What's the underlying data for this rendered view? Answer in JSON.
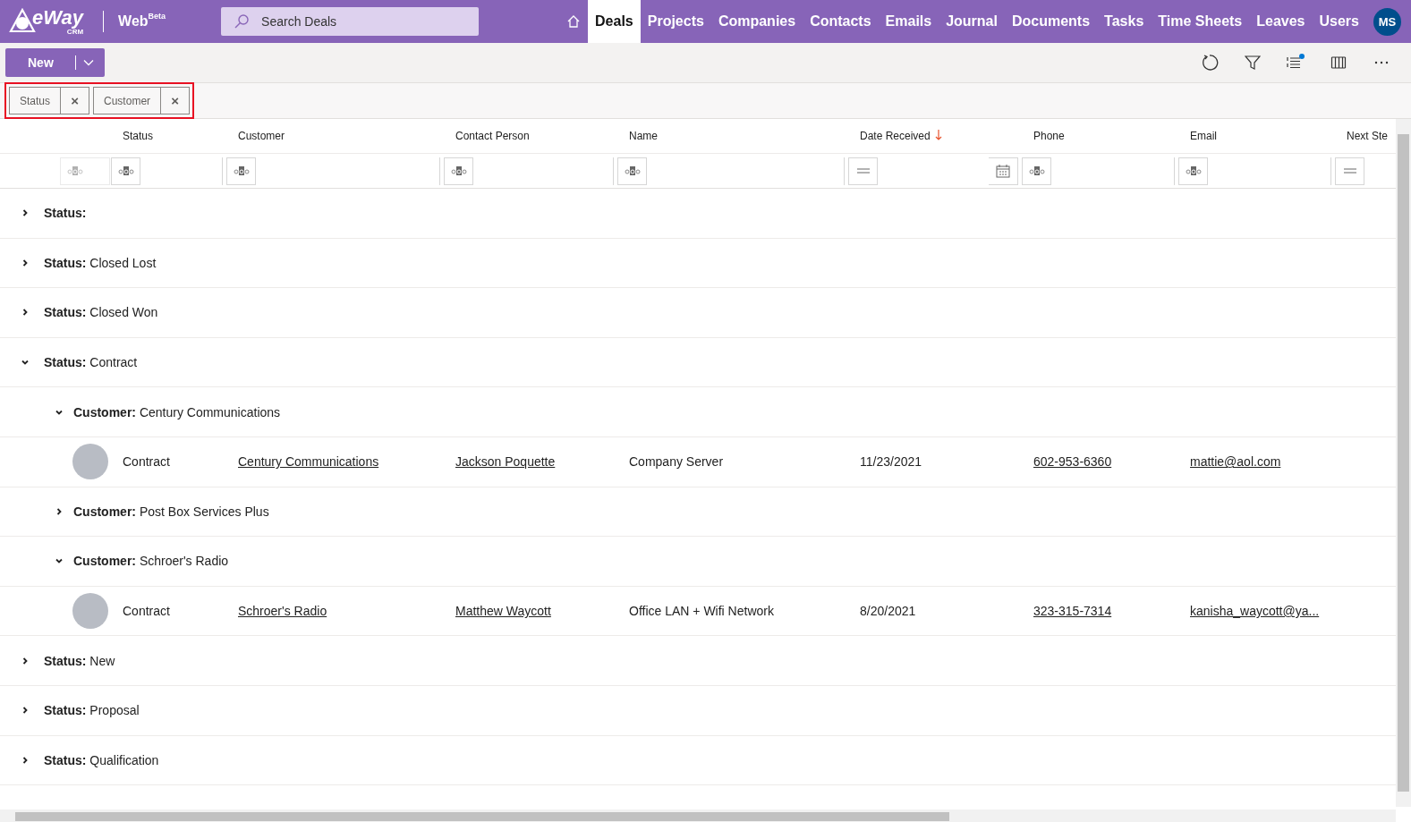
{
  "app": {
    "logo": "eWay",
    "logo_sub": "CRM",
    "product": "Web",
    "product_badge": "Beta"
  },
  "search": {
    "placeholder": "Search Deals"
  },
  "nav": [
    {
      "label": "Deals",
      "selected": true
    },
    {
      "label": "Projects",
      "selected": false
    },
    {
      "label": "Companies",
      "selected": false
    },
    {
      "label": "Contacts",
      "selected": false
    },
    {
      "label": "Emails",
      "selected": false
    },
    {
      "label": "Journal",
      "selected": false
    },
    {
      "label": "Documents",
      "selected": false
    },
    {
      "label": "Tasks",
      "selected": false
    },
    {
      "label": "Time Sheets",
      "selected": false
    },
    {
      "label": "Leaves",
      "selected": false
    },
    {
      "label": "Users",
      "selected": false
    }
  ],
  "user": {
    "initials": "MS"
  },
  "toolbar": {
    "new_button": "New",
    "grouping_has_notification": true
  },
  "group_by": [
    {
      "label": "Status",
      "remove": "×"
    },
    {
      "label": "Customer",
      "remove": "×"
    }
  ],
  "columns": [
    {
      "label": "Status",
      "kind": "text",
      "sorted": false
    },
    {
      "label": "Customer",
      "kind": "text",
      "sorted": false
    },
    {
      "label": "Contact Person",
      "kind": "text",
      "sorted": false
    },
    {
      "label": "Name",
      "kind": "text",
      "sorted": false
    },
    {
      "label": "Date Received",
      "kind": "date",
      "sorted": true
    },
    {
      "label": "Phone",
      "kind": "text",
      "sorted": false
    },
    {
      "label": "Email",
      "kind": "text",
      "sorted": false
    },
    {
      "label": "Next Ste",
      "kind": "number",
      "sorted": false
    }
  ],
  "groups": [
    {
      "field": "Status:",
      "expanded": false
    },
    {
      "field": "Status:",
      "value": "Closed Lost",
      "expanded": false
    },
    {
      "field": "Status:",
      "value": "Closed Won",
      "expanded": false
    },
    {
      "field": "Status:",
      "value": "Contract",
      "expanded": true,
      "children": [
        {
          "field": "Customer:",
          "value": "Century Communications",
          "expanded": true,
          "rows": [
            {
              "status": "Contract",
              "customer": "Century Communications",
              "contact": "Jackson Poquette",
              "name": "Company Server",
              "date": "11/23/2021",
              "phone": "602-953-6360",
              "email": "mattie@aol.com"
            }
          ]
        },
        {
          "field": "Customer:",
          "value": "Post Box Services Plus",
          "expanded": false
        },
        {
          "field": "Customer:",
          "value": "Schroer's Radio",
          "expanded": true,
          "rows": [
            {
              "status": "Contract",
              "customer": "Schroer's Radio",
              "contact": "Matthew Waycott",
              "name": "Office LAN + Wifi Network",
              "date": "8/20/2021",
              "phone": "323-315-7314",
              "email": "kanisha_waycott@ya..."
            }
          ]
        }
      ]
    },
    {
      "field": "Status:",
      "value": "New",
      "expanded": false
    },
    {
      "field": "Status:",
      "value": "Proposal",
      "expanded": false
    },
    {
      "field": "Status:",
      "value": "Qualification",
      "expanded": false
    }
  ]
}
